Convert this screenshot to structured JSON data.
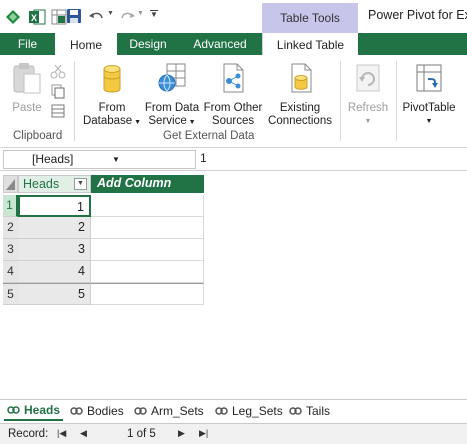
{
  "window": {
    "title": "Power Pivot for Exc"
  },
  "qat": {
    "undo_icon": "undo-icon",
    "redo_icon": "redo-icon"
  },
  "contextual_tab": {
    "label": "Table Tools"
  },
  "tabs": {
    "file": "File",
    "home": "Home",
    "design": "Design",
    "advanced": "Advanced",
    "linked_table": "Linked Table"
  },
  "ribbon": {
    "paste": "Paste",
    "from_database": [
      "From",
      "Database"
    ],
    "from_data_service": [
      "From Data",
      "Service"
    ],
    "from_other_sources": [
      "From Other",
      "Sources"
    ],
    "existing_connections": [
      "Existing",
      "Connections"
    ],
    "refresh": "Refresh",
    "pivottable": "PivotTable",
    "group_clipboard": "Clipboard",
    "group_get_external_data": "Get External Data"
  },
  "formula_bar": {
    "name_box": "[Heads]",
    "value": "1"
  },
  "grid": {
    "column_header": "Heads",
    "add_column": "Add Column",
    "row_numbers": [
      "1",
      "2",
      "3",
      "4",
      "5"
    ],
    "values": [
      "1",
      "2",
      "3",
      "4",
      "5"
    ]
  },
  "sheets": [
    "Heads",
    "Bodies",
    "Arm_Sets",
    "Leg_Sets",
    "Tails"
  ],
  "status": {
    "record_label": "Record:",
    "position": "1 of 5"
  },
  "colors": {
    "accent": "#217346",
    "contextual": "#c8c5ea"
  }
}
